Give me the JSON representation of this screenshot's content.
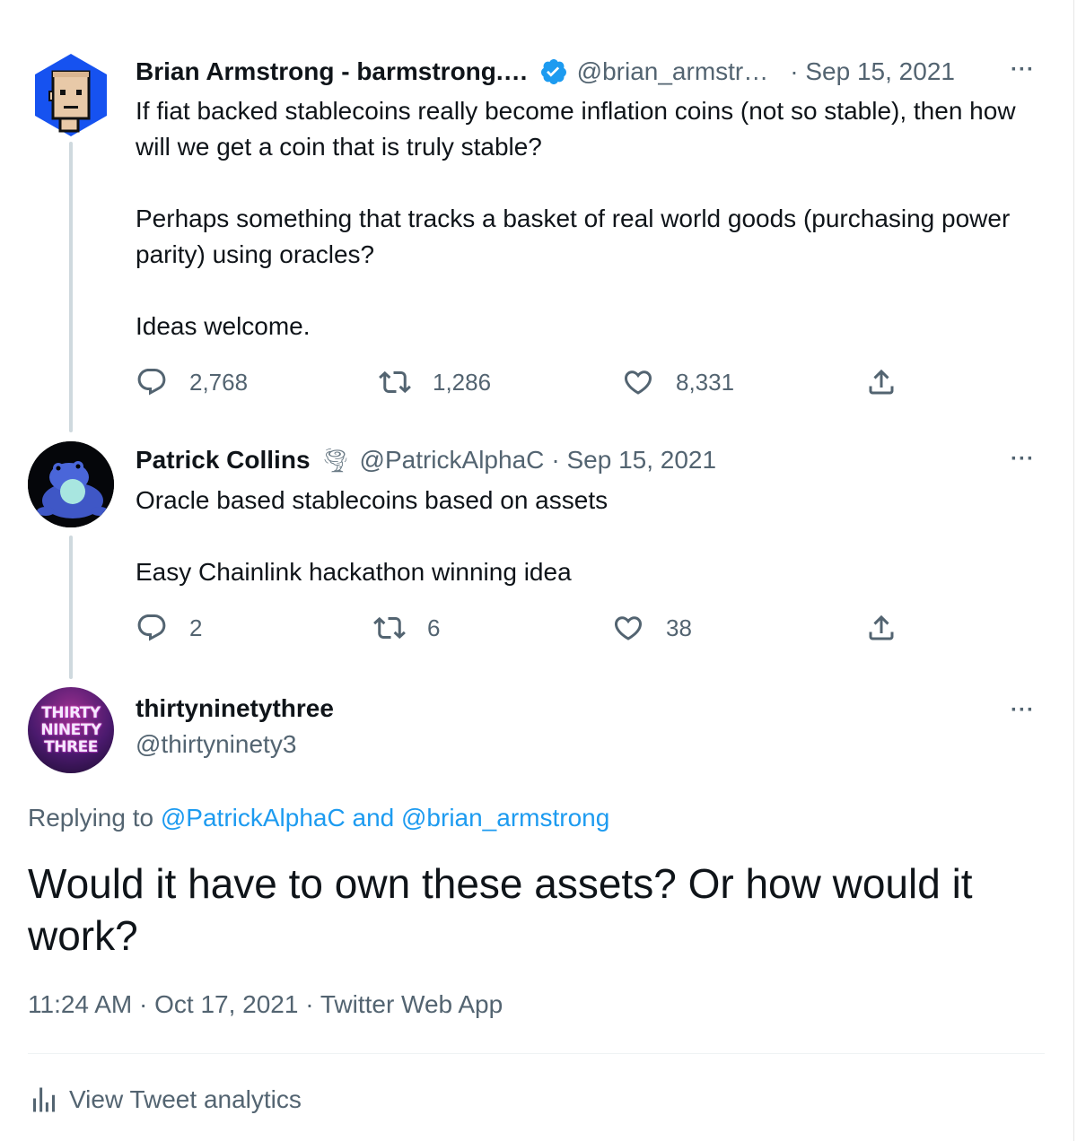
{
  "tweets": [
    {
      "name": "Brian Armstrong - barmstrong.…",
      "handle": "@brian_armstr…",
      "date": "· Sep 15, 2021",
      "more": "···",
      "paragraphs": [
        "If fiat backed stablecoins really become inflation coins (not so stable), then how will we get a coin that is truly stable?",
        "Perhaps something that tracks a basket of real world goods (purchasing power parity) using oracles?",
        "Ideas welcome."
      ],
      "replies": "2,768",
      "retweets": "1,286",
      "likes": "8,331"
    },
    {
      "name": "Patrick Collins",
      "emoji": "🌪",
      "handle": "@PatrickAlphaC",
      "date": "· Sep 15, 2021",
      "more": "···",
      "paragraphs": [
        "Oracle based stablecoins based on assets",
        "Easy Chainlink hackathon winning idea"
      ],
      "replies": "2",
      "retweets": "6",
      "likes": "38"
    }
  ],
  "main": {
    "name": "thirtyninetythree",
    "handle": "@thirtyninety3",
    "more": "···",
    "avatar_text": [
      "THIRTY",
      "NINETY",
      "THREE"
    ],
    "replying_prefix": "Replying to",
    "replying_user1": "@PatrickAlphaC",
    "replying_and": "and",
    "replying_user2": "@brian_armstrong",
    "text": "Would it have to own these assets? Or how would it work?",
    "timestamp": "11:24 AM · Oct 17, 2021 · Twitter Web App",
    "analytics_label": "View Tweet analytics"
  },
  "colors": {
    "verified": "#1d9bf0",
    "link": "#1d9bf0",
    "muted": "#536471",
    "avatar1_bg": "#1652f0"
  },
  "icons": [
    "verified-badge-icon",
    "reply-icon",
    "retweet-icon",
    "like-icon",
    "share-icon",
    "analytics-icon"
  ]
}
